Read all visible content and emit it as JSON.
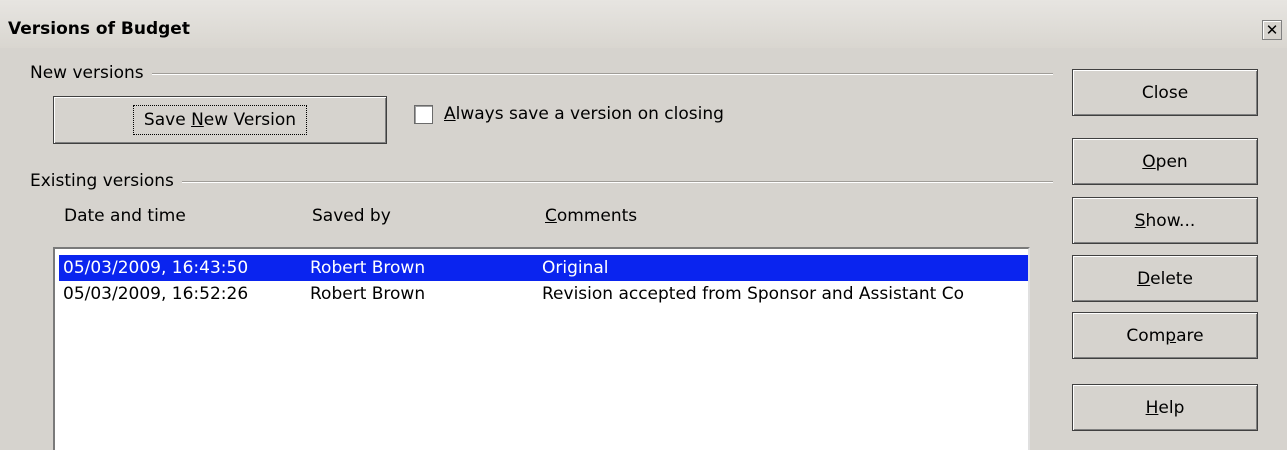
{
  "window": {
    "title": "Versions of Budget",
    "close_glyph": "✕"
  },
  "new_versions": {
    "label": "New versions",
    "save_button": {
      "pre": "Save ",
      "mnemonic": "N",
      "post": "ew Version"
    },
    "always_save": {
      "mnemonic": "A",
      "post": "lways save a version on closing",
      "checked": false
    }
  },
  "existing_versions": {
    "label": "Existing versions",
    "columns": {
      "date": "Date and time",
      "saved_by": "Saved by",
      "comments_mnemonic": "C",
      "comments_post": "omments"
    },
    "rows": [
      {
        "date": "05/03/2009, 16:43:50",
        "saved_by": "Robert Brown",
        "comment": "Original",
        "selected": true
      },
      {
        "date": "05/03/2009, 16:52:26",
        "saved_by": "Robert Brown",
        "comment": "Revision accepted from Sponsor and Assistant Co",
        "selected": false
      }
    ]
  },
  "buttons": {
    "close": {
      "label": "Close"
    },
    "open": {
      "mnemonic": "O",
      "post": "pen"
    },
    "show": {
      "mnemonic": "S",
      "post": "how..."
    },
    "delete": {
      "mnemonic": "D",
      "post": "elete"
    },
    "compare": {
      "pre": "Com",
      "mnemonic": "p",
      "post": "are"
    },
    "help": {
      "mnemonic": "H",
      "post": "elp"
    }
  },
  "colors": {
    "dialog_bg": "#d6d3ce",
    "selection": "#0a24ef"
  }
}
